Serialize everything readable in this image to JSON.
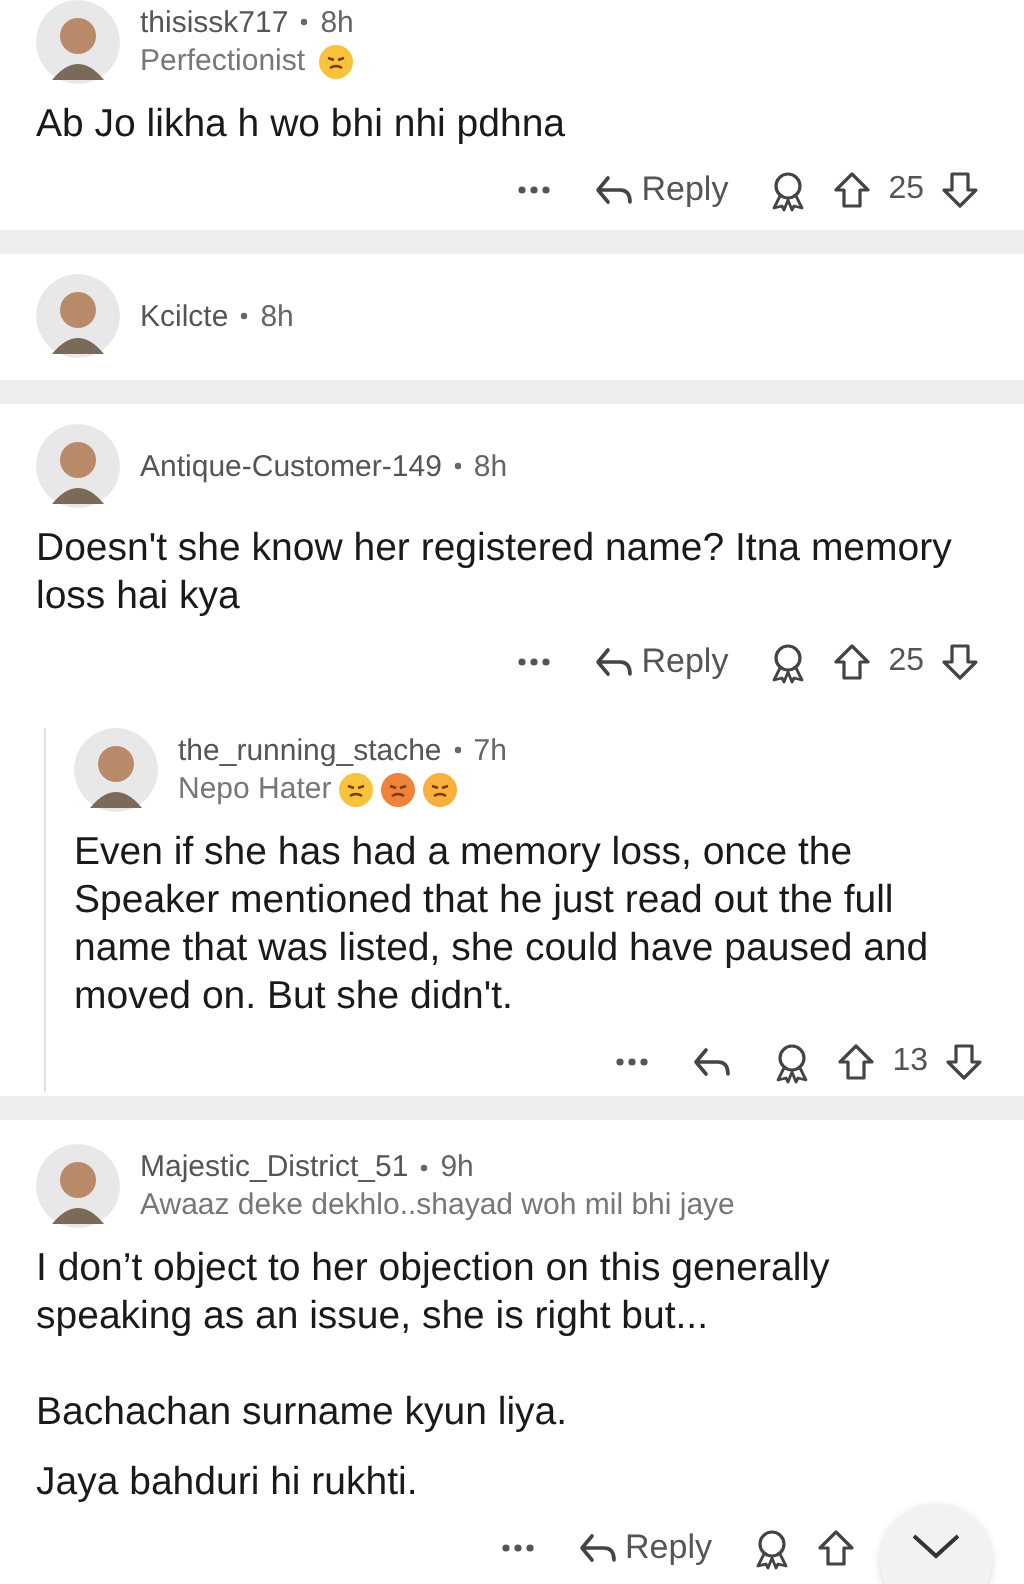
{
  "comments": [
    {
      "author": "thisissk717",
      "time": "8h",
      "flair": "Perfectionist",
      "flair_emojis": [
        {
          "color": "#f7c23c"
        }
      ],
      "body": [
        "Ab Jo likha h wo bhi nhi pdhna"
      ],
      "nested": false,
      "actions": {
        "reply_label": "Reply",
        "score": "25"
      }
    },
    {
      "author": "Kcilcte",
      "time": "8h",
      "nested": false
    },
    {
      "author": "Antique-Customer-149",
      "time": "8h",
      "body": [
        "Doesn't she know her registered name? Itna memory loss hai kya"
      ],
      "nested": false,
      "actions": {
        "reply_label": "Reply",
        "score": "25"
      }
    },
    {
      "author": "the_running_stache",
      "time": "7h",
      "flair": "Nepo Hater",
      "flair_emojis": [
        {
          "color": "#f7c23c"
        },
        {
          "color": "#f0833a"
        },
        {
          "color": "#f7b13c"
        }
      ],
      "body": [
        "Even if she has had a memory loss, once the Speaker mentioned that he just read out the full name that was listed, she could have paused and moved on. But she didn't."
      ],
      "nested": true,
      "actions": {
        "score": "13"
      }
    },
    {
      "author": "Majestic_District_51",
      "time": "9h",
      "flair": "Awaaz deke dekhlo..shayad woh mil bhi jaye",
      "body": [
        "I don’t object to her objection on this generally speaking as an issue, she is right but...",
        "Bachachan surname kyun liya.",
        "Jaya bahduri hi rukhti."
      ],
      "nested": false,
      "actions": {
        "reply_label": "Reply"
      }
    }
  ]
}
